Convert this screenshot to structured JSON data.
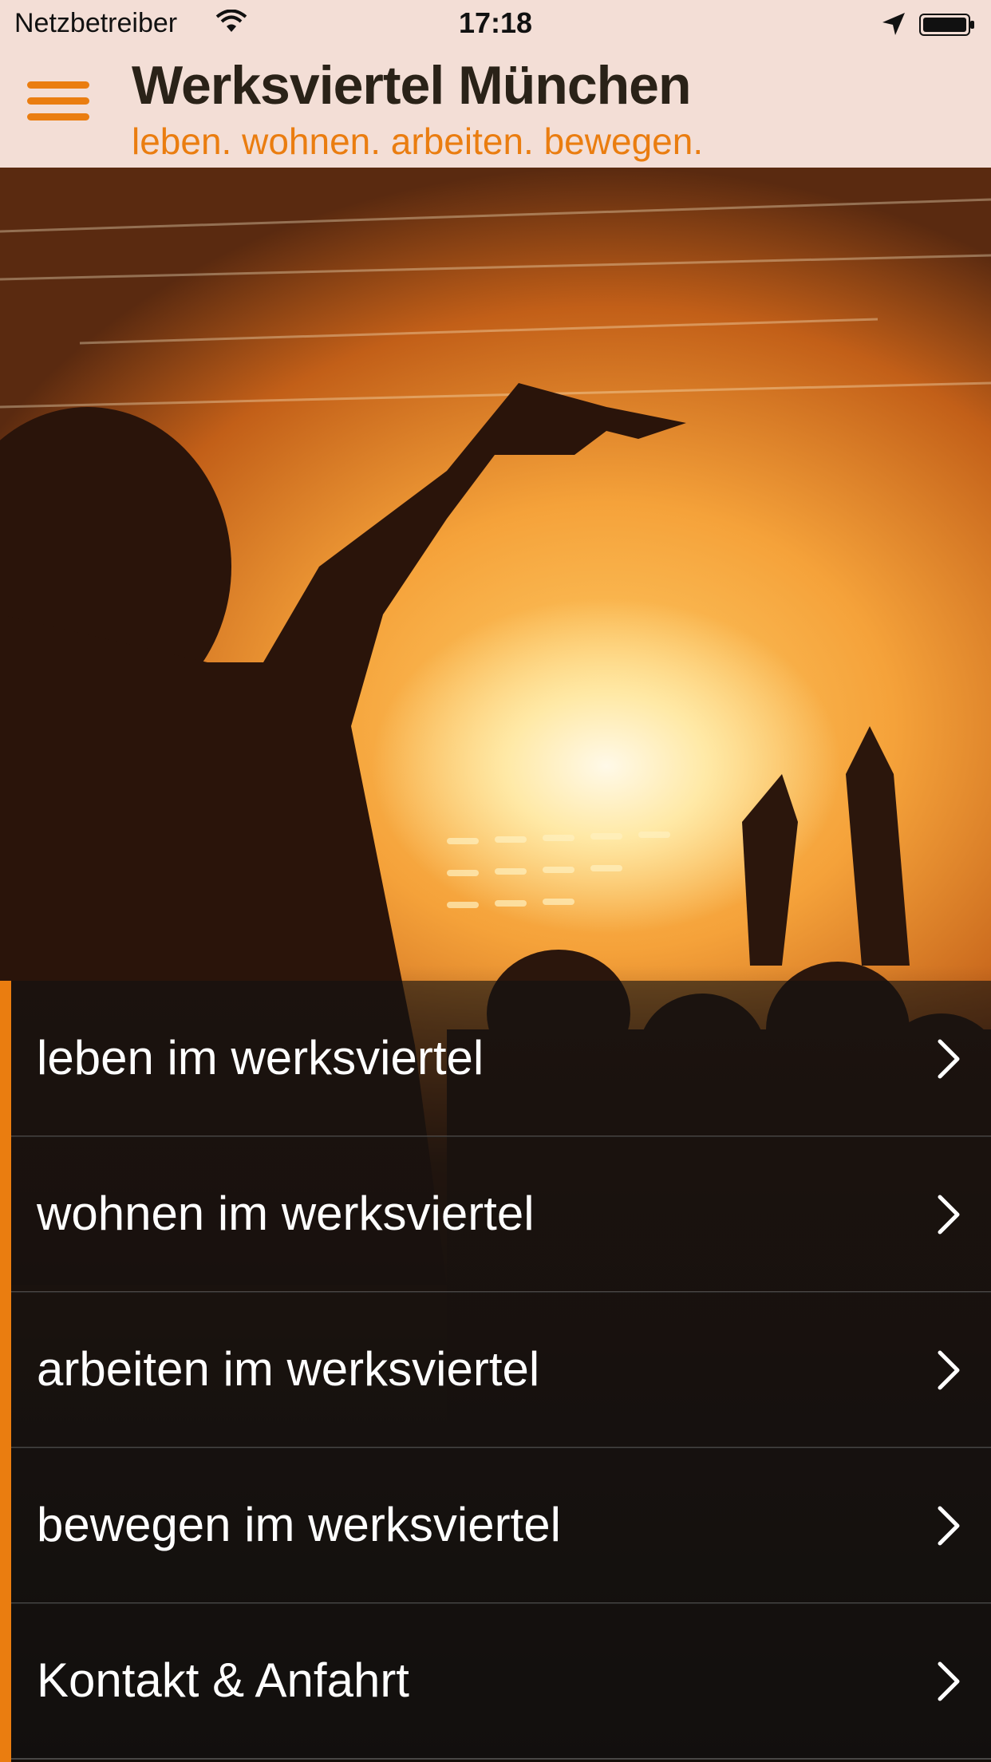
{
  "status_bar": {
    "carrier": "Netzbetreiber",
    "time": "17:18",
    "icons": [
      "wifi-icon",
      "location-arrow-icon",
      "battery-icon"
    ]
  },
  "header": {
    "title": "Werksviertel München",
    "subtitle": "leben. wohnen. arbeiten. bewegen.",
    "menu_icon": "hamburger-menu-icon"
  },
  "colors": {
    "accent": "#ea7d10",
    "header_bg": "#f3ded6",
    "title_text": "#2a2218"
  },
  "menu": {
    "items": [
      {
        "label": "leben im werksviertel",
        "icon": "chevron-right-icon"
      },
      {
        "label": "wohnen im werksviertel",
        "icon": "chevron-right-icon"
      },
      {
        "label": "arbeiten im werksviertel",
        "icon": "chevron-right-icon"
      },
      {
        "label": "bewegen im werksviertel",
        "icon": "chevron-right-icon"
      },
      {
        "label": "Kontakt & Anfahrt",
        "icon": "chevron-right-icon"
      }
    ]
  }
}
